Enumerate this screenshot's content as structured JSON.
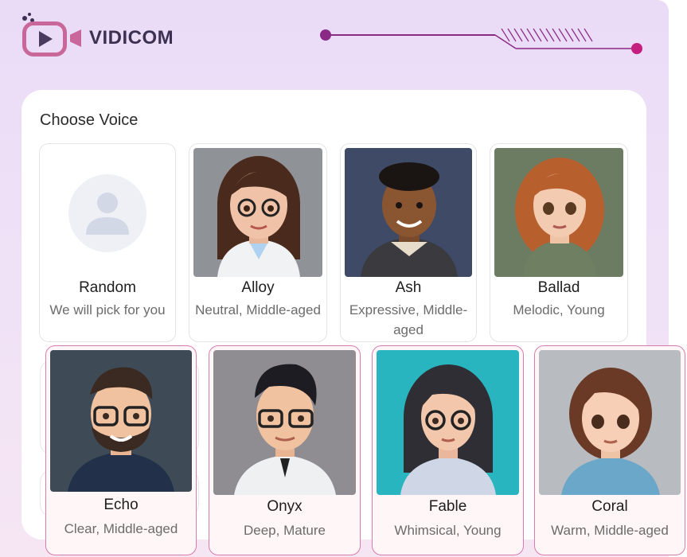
{
  "brand": {
    "name": "VIDICOM"
  },
  "colors": {
    "accent": "#c9679b",
    "deco_line": "#8a2a85",
    "deco_dot": "#c41f7e"
  },
  "voice_picker": {
    "title": "Choose Voice",
    "voices": [
      {
        "name": "Random",
        "desc": "We will pick for you",
        "icon": "user-placeholder-icon"
      },
      {
        "name": "Alloy",
        "desc": "Neutral, Middle-aged"
      },
      {
        "name": "Ash",
        "desc": "Expressive, Middle-aged"
      },
      {
        "name": "Ballad",
        "desc": "Melodic, Young"
      },
      {
        "name": "Echo",
        "desc": "Clear, Middle-aged"
      },
      {
        "name": "Onyx",
        "desc": "Deep, Mature"
      },
      {
        "name": "Fable",
        "desc": "Whimsical, Young"
      },
      {
        "name": "Coral",
        "desc": "Warm, Middle-aged"
      }
    ]
  }
}
